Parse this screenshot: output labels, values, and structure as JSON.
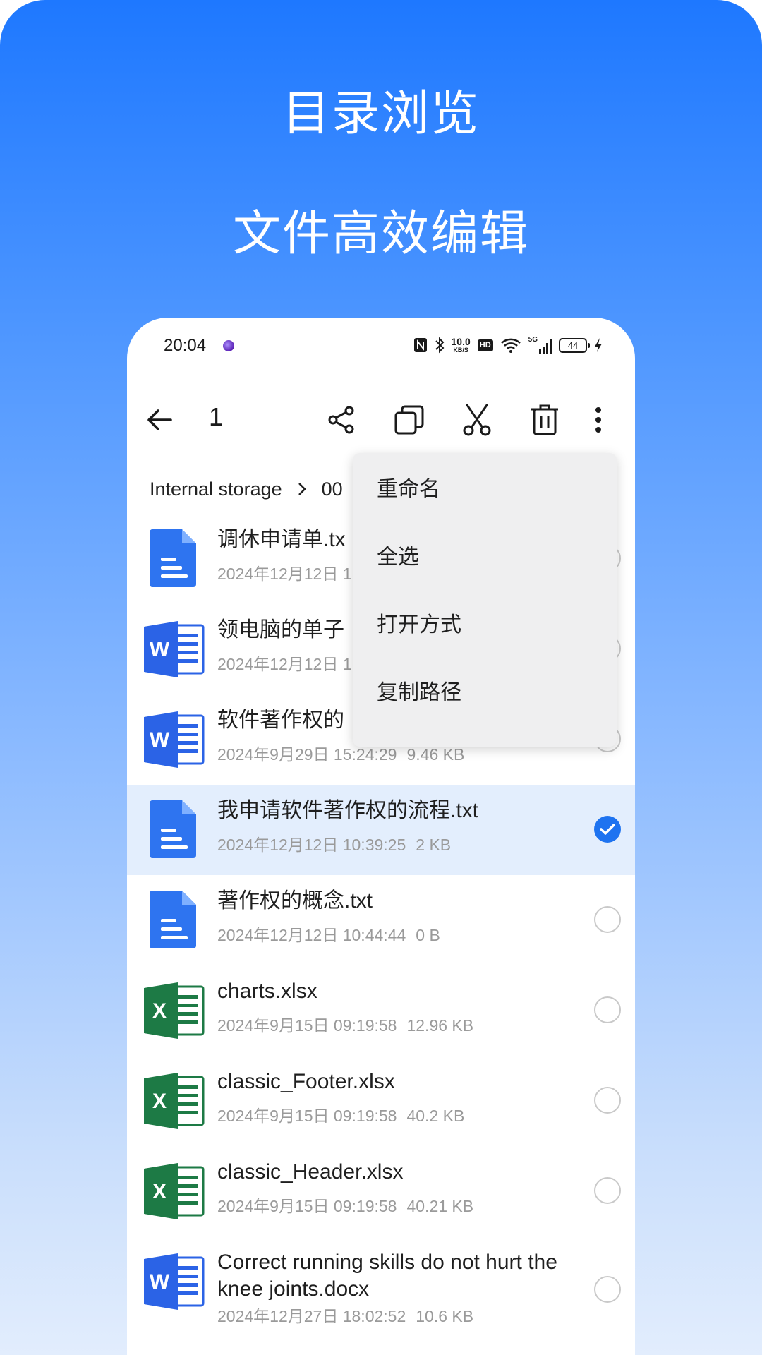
{
  "promo": {
    "headline1": "目录浏览",
    "headline2": "文件高效编辑"
  },
  "status_bar": {
    "time": "20:04",
    "net_speed_top": "10.0",
    "net_speed_unit": "KB/S",
    "hd": "HD",
    "network": "5G",
    "battery": "44"
  },
  "toolbar": {
    "selected_count": "1",
    "icons": [
      "back-arrow-icon",
      "share-icon",
      "copy-icon",
      "cut-icon",
      "delete-icon",
      "more-vertical-icon"
    ]
  },
  "breadcrumb": {
    "root": "Internal storage",
    "current": "00"
  },
  "menu": {
    "items": [
      "重命名",
      "全选",
      "打开方式",
      "复制路径"
    ]
  },
  "files": [
    {
      "name": "调休申请单.tx",
      "date": "2024年12月12日 1",
      "size": "",
      "type": "txt",
      "selected": false
    },
    {
      "name": "领电脑的单子",
      "date": "2024年12月12日 1",
      "size": "",
      "type": "word",
      "selected": false
    },
    {
      "name": "软件著作权的",
      "date": "2024年9月29日 15:24:29",
      "size": "9.46 KB",
      "type": "word",
      "selected": false
    },
    {
      "name": "我申请软件著作权的流程.txt",
      "date": "2024年12月12日 10:39:25",
      "size": "2 KB",
      "type": "txt",
      "selected": true
    },
    {
      "name": "著作权的概念.txt",
      "date": "2024年12月12日 10:44:44",
      "size": "0 B",
      "type": "txt",
      "selected": false
    },
    {
      "name": "charts.xlsx",
      "date": "2024年9月15日 09:19:58",
      "size": "12.96 KB",
      "type": "excel",
      "selected": false
    },
    {
      "name": "classic_Footer.xlsx",
      "date": "2024年9月15日 09:19:58",
      "size": "40.2 KB",
      "type": "excel",
      "selected": false
    },
    {
      "name": "classic_Header.xlsx",
      "date": "2024年9月15日 09:19:58",
      "size": "40.21 KB",
      "type": "excel",
      "selected": false
    },
    {
      "name": "Correct running skills do not hurt the knee joints.docx",
      "date": "2024年12月27日 18:02:52",
      "size": "10.6 KB",
      "type": "word",
      "selected": false
    }
  ],
  "colors": {
    "accent": "#1e73f0",
    "word": "#2b63e6",
    "excel": "#1d7a45",
    "txt": "#2e74f0",
    "selected_row": "#e3eefd"
  }
}
